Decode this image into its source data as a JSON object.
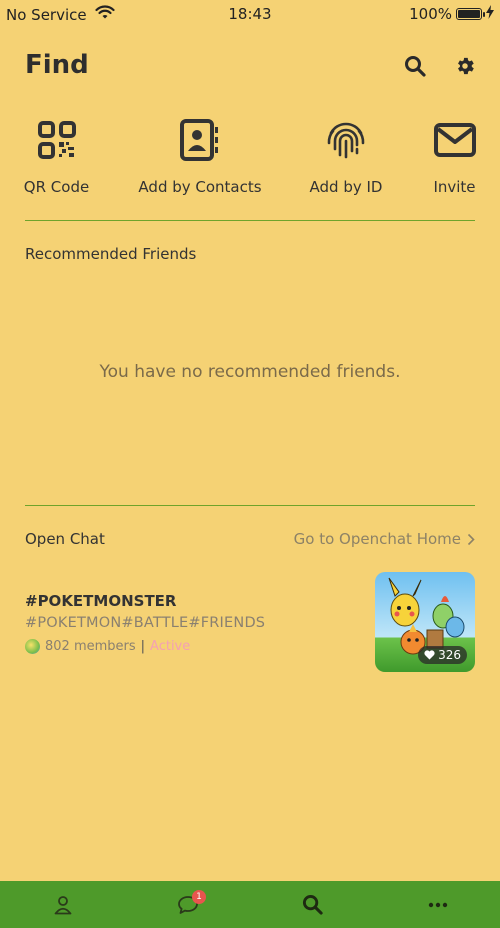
{
  "status_bar": {
    "carrier": "No Service",
    "time": "18:43",
    "battery": "100%"
  },
  "header": {
    "title": "Find"
  },
  "quick_actions": [
    {
      "label": "QR Code",
      "icon": "qr-code-icon"
    },
    {
      "label": "Add by Contacts",
      "icon": "contacts-book-icon"
    },
    {
      "label": "Add by ID",
      "icon": "fingerprint-icon"
    },
    {
      "label": "Invite",
      "icon": "envelope-icon"
    }
  ],
  "recommended": {
    "title": "Recommended Friends",
    "empty_message": "You have no recommended friends."
  },
  "open_chat": {
    "title": "Open Chat",
    "home_link": "Go to Openchat Home",
    "room": {
      "name": "#POKETMONSTER",
      "tags": "#POKETMON#BATTLE#FRIENDS",
      "members": "802 members",
      "status": "Active",
      "likes": "326"
    }
  },
  "tab_bar": {
    "items": [
      "profile",
      "chats",
      "find",
      "more"
    ],
    "chat_badge": "1"
  },
  "colors": {
    "background": "#F5D274",
    "accent_green": "#4E9A2A",
    "badge_red": "#E8554E"
  }
}
